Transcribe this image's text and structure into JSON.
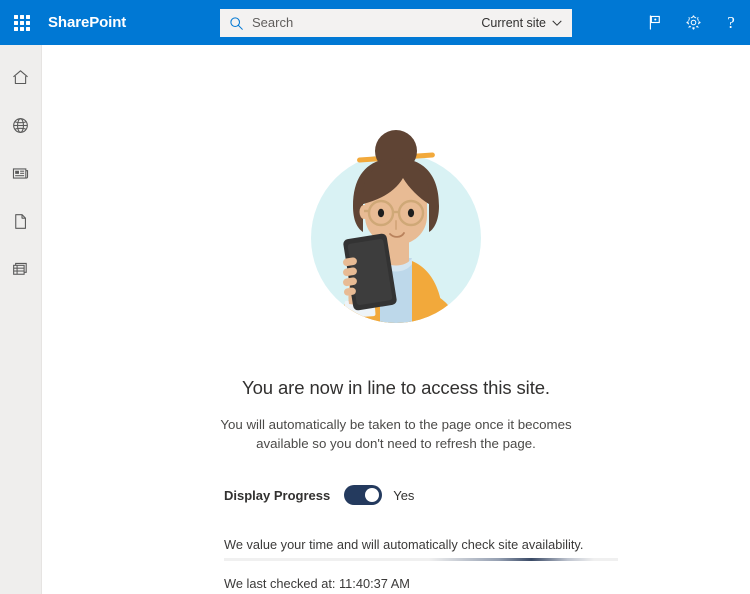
{
  "suite": {
    "waffle_label": "app-launcher",
    "brand": "SharePoint",
    "actions": [
      {
        "name": "feedback-icon",
        "label": "Feedback"
      },
      {
        "name": "settings-icon",
        "label": "Settings"
      },
      {
        "name": "help-icon",
        "label": "?"
      }
    ],
    "brand_color": "#0078d4"
  },
  "search": {
    "placeholder": "Search",
    "value": "",
    "scope": "Current site",
    "icon": "search-icon",
    "chevron": "chevron-down-icon"
  },
  "rail": {
    "items": [
      {
        "name": "sidebar-item-home",
        "icon": "home-icon",
        "label": "Home"
      },
      {
        "name": "sidebar-item-web",
        "icon": "globe-icon",
        "label": "Web"
      },
      {
        "name": "sidebar-item-news",
        "icon": "news-icon",
        "label": "News"
      },
      {
        "name": "sidebar-item-documents",
        "icon": "document-icon",
        "label": "Documents"
      },
      {
        "name": "sidebar-item-lists",
        "icon": "list-icon",
        "label": "Lists"
      }
    ]
  },
  "main": {
    "illustration": "person-with-phone-illustration",
    "headline": "You are now in line to access this site.",
    "subtext": "You will automatically be taken to the page once it becomes available so you don't need to refresh the page.",
    "display_progress_label": "Display Progress",
    "display_progress_state": "Yes",
    "display_progress_on": true,
    "status_message": "We value your time and will automatically check site availability.",
    "last_checked": "We last checked at: 11:40:37 AM"
  },
  "colors": {
    "suite_bar": "#0078d4",
    "rail_bg": "#efeeed",
    "toggle_on": "#243a5e",
    "text_primary": "#323130",
    "illustration_circle": "#d9f2f4",
    "illustration_jacket": "#f2a93b",
    "illustration_shirt": "#bdd8ea",
    "illustration_hair": "#5f4434",
    "illustration_skin": "#e8bb94",
    "illustration_phone": "#333333"
  }
}
